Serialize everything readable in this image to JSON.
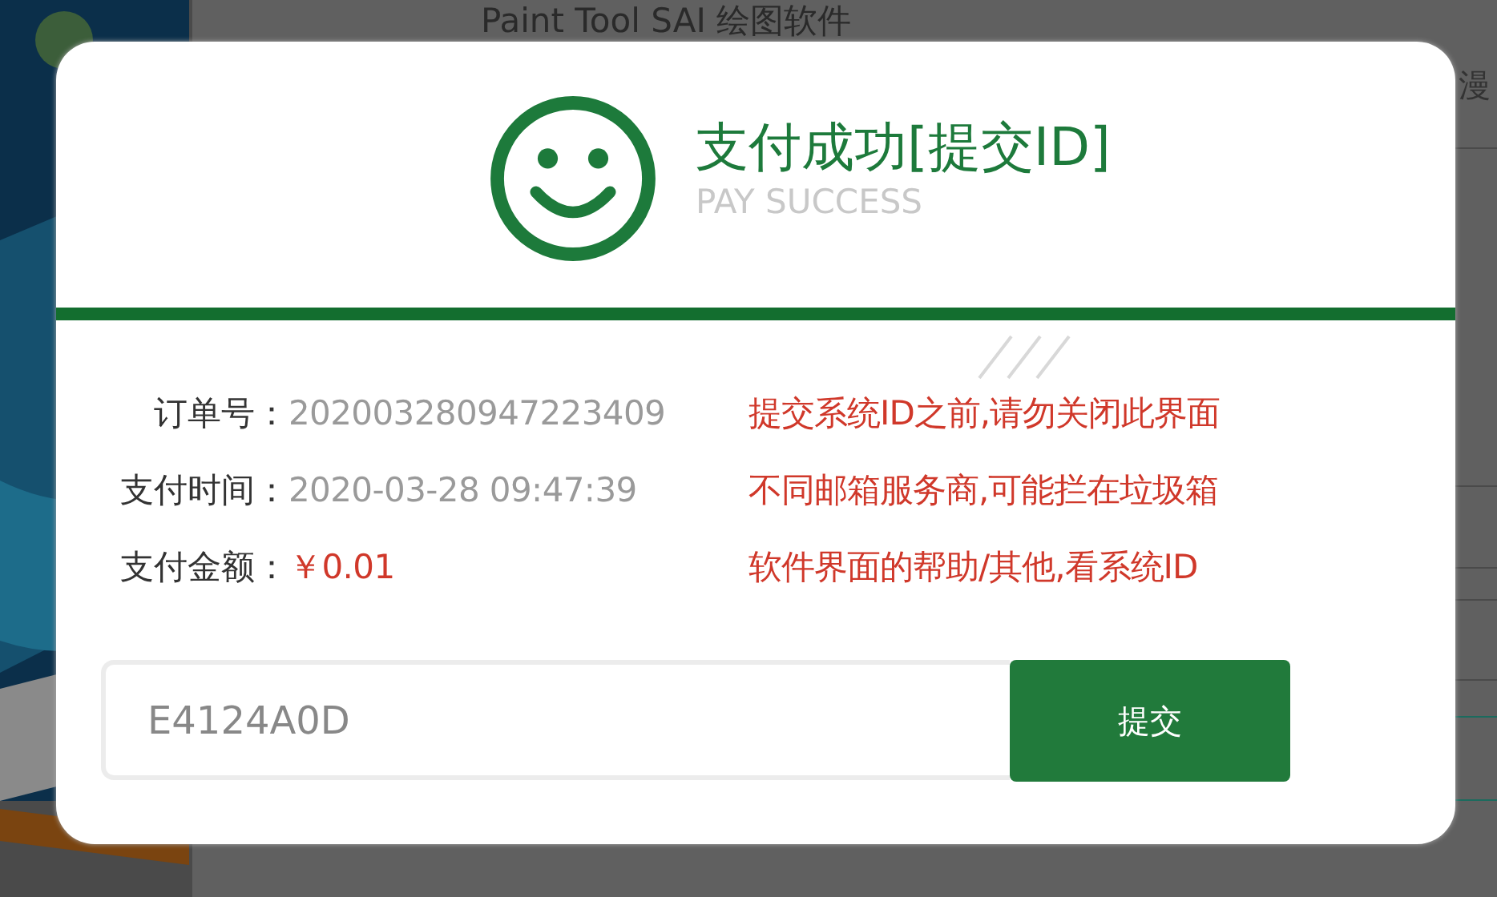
{
  "background": {
    "title": "Paint Tool SAI 绘图软件",
    "side_text": "漫"
  },
  "dialog": {
    "title": "支付成功[提交ID]",
    "subtitle": "PAY SUCCESS",
    "details": [
      {
        "label": "订单号：",
        "value": "202003280947223409",
        "kind": "plain"
      },
      {
        "label": "支付时间：",
        "value": "2020-03-28 09:47:39",
        "kind": "plain"
      },
      {
        "label": "支付金额：",
        "value": "￥0.01",
        "kind": "money"
      }
    ],
    "notices": [
      "提交系统ID之前,请勿关闭此界面",
      "不同邮箱服务商,可能拦在垃圾箱",
      "软件界面的帮助/其他,看系统ID"
    ],
    "id_field": {
      "value": "E4124A0D"
    },
    "submit": "提交"
  }
}
